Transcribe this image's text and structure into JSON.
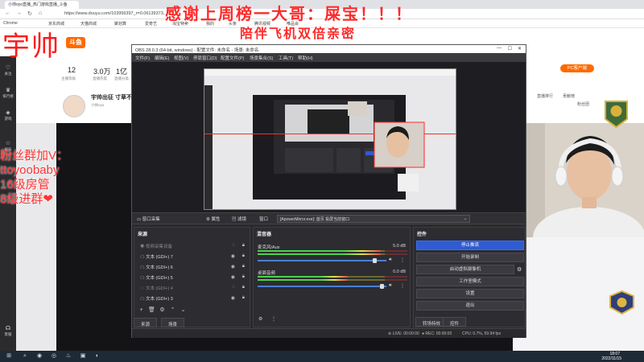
{
  "browser": {
    "tab_title": "小帅oyo直播_热门游戏直播_斗鱼",
    "url": "https://www.douyu.com/103956397_r=0.06139373...",
    "bookmarks": [
      "Chrome",
      "京东商城",
      "天猫商城",
      "聚划算",
      "爱奇艺",
      "淘宝特卖",
      "我的",
      "头条",
      "腾讯视频",
      "唯品会"
    ]
  },
  "overlay": {
    "thanks_line1": "感谢上周榜一大哥：屎宝！！！",
    "thanks_line2": "陪伴飞机双倍亲密",
    "streamer_handle": "宇帅",
    "fan_group": [
      "粉丝群加V：",
      "ttoyoobaby",
      "16级房管",
      "8级进群❤"
    ]
  },
  "site": {
    "logo": "斗鱼",
    "pc_client": "PC客户端",
    "stats": [
      {
        "value": "12",
        "label": "主播等级"
      },
      {
        "value": "3.0万",
        "label": "直播热度"
      },
      {
        "value": "1亿",
        "label": "直播分类"
      }
    ],
    "streamer_name": "宇帅出征 寸草不生",
    "sub_name": "小帅oyo",
    "sidebar": [
      "关注",
      "排行榜",
      "游戏",
      "娱乐",
      "客服"
    ],
    "right_tabs": [
      "直播排行",
      "贡献榜",
      "粉丝团"
    ]
  },
  "obs": {
    "title": "OBS 28.0.3 (64-bit, windows) - 配置文件: 未命名 - 场景: 未命名",
    "menu": [
      "文件(F)",
      "编辑(E)",
      "视图(V)",
      "停靠窗口(D)",
      "配置文件(P)",
      "场景集合(S)",
      "工具(T)",
      "帮助(H)"
    ],
    "source_toolbar": {
      "current_source": "窗口采集",
      "properties": "属性",
      "filters": "滤镜",
      "window_label": "窗口",
      "window_value": "[ApowerMirror.exe]: 首页 投屏当前窗口"
    },
    "sources": {
      "title": "来源",
      "items": [
        {
          "name": "视频采集设备",
          "hidden": true
        },
        {
          "name": "文本 (GDI+) 7",
          "hidden": false
        },
        {
          "name": "文本 (GDI+) 6",
          "hidden": false
        },
        {
          "name": "文本 (GDI+) 5",
          "hidden": false
        },
        {
          "name": "文本 (GDI+) 4",
          "hidden": true
        },
        {
          "name": "文本 (GDI+) 3",
          "hidden": false
        }
      ],
      "tabs": [
        "来源",
        "场景"
      ]
    },
    "mixer": {
      "title": "混音器",
      "channels": [
        {
          "name": "麦克风/Aux",
          "db": "5.0 dB",
          "level": 0.82,
          "volume": 0.92
        },
        {
          "name": "桌面音频",
          "db": "0.0 dB",
          "level": 0.6,
          "volume": 0.98
        }
      ]
    },
    "controls": {
      "title": "控件",
      "buttons": [
        "停止推流",
        "开始录制",
        "启动虚拟摄像机",
        "工作室模式",
        "设置",
        "退出"
      ],
      "tabs": [
        "转场特效",
        "控件"
      ]
    },
    "status": {
      "live": "LIVE: 00:00:00",
      "rec": "REC: 00:00:00",
      "cpu": "CPU: 0.7%, 59.94 fps"
    }
  },
  "taskbar": {
    "time": "18:07",
    "date": "2022/11/15"
  },
  "colors": {
    "overlay_red": "#ff2a2a",
    "obs_primary": "#2f5bd3",
    "brand_orange": "#ff6a00"
  }
}
